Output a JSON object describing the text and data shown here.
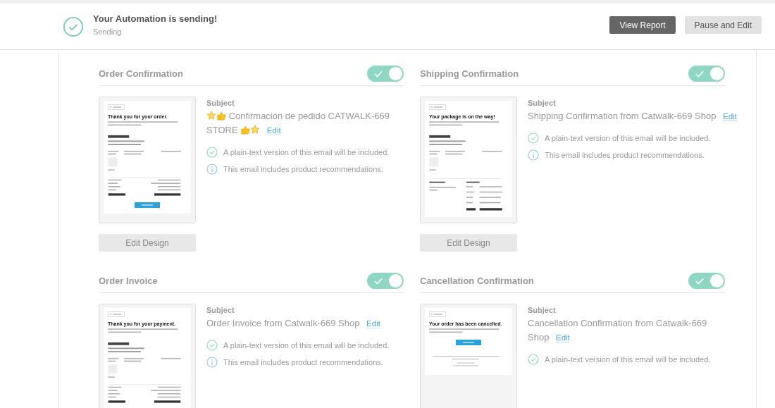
{
  "status": {
    "title": "Your Automation is sending!",
    "subtitle": "Sending"
  },
  "actions": [
    {
      "label": "View Report",
      "kind": "primary"
    },
    {
      "label": "Pause and Edit",
      "kind": "secondary"
    }
  ],
  "emails": [
    {
      "title": "Order Confirmation",
      "on": true,
      "subject_lines": [
        "Confirmación de pedido CATWALK-669",
        "STORE"
      ],
      "decorated": true,
      "edit": "Edit",
      "subject_label": "Subject",
      "design_button": "Edit Design",
      "notes": [
        {
          "kind": "check",
          "text": "A plain-text version of this email will be included."
        },
        {
          "kind": "info",
          "text": "This email includes product recommendations."
        }
      ],
      "preview": {
        "heading": "Thank you for your order.",
        "blocks": [
          {
            "kind": "text"
          },
          {
            "kind": "details"
          },
          {
            "kind": "product"
          },
          {
            "kind": "totals"
          },
          {
            "kind": "button"
          }
        ]
      }
    },
    {
      "title": "Shipping Confirmation",
      "on": true,
      "subject_lines": [
        "Shipping Confirmation from Catwalk-669 Shop"
      ],
      "decorated": false,
      "edit": "Edit",
      "subject_label": "Subject",
      "design_button": "Edit Design",
      "notes": [
        {
          "kind": "check",
          "text": "A plain-text version of this email will be included."
        },
        {
          "kind": "info",
          "text": "This email includes product recommendations."
        }
      ],
      "preview": {
        "heading": "Your package is on the way!",
        "blocks": [
          {
            "kind": "text"
          },
          {
            "kind": "details"
          },
          {
            "kind": "product"
          },
          {
            "kind": "split"
          }
        ]
      }
    },
    {
      "title": "Order Invoice",
      "on": true,
      "subject_lines": [
        "Order Invoice from Catwalk-669 Shop"
      ],
      "decorated": false,
      "edit": "Edit",
      "subject_label": "Subject",
      "notes": [
        {
          "kind": "check",
          "text": "A plain-text version of this email will be included."
        },
        {
          "kind": "info",
          "text": "This email includes product recommendations."
        }
      ],
      "preview": {
        "heading": "Thank you for your payment.",
        "blocks": [
          {
            "kind": "text"
          },
          {
            "kind": "details"
          },
          {
            "kind": "product"
          },
          {
            "kind": "totals"
          }
        ]
      }
    },
    {
      "title": "Cancellation Confirmation",
      "on": true,
      "subject_lines": [
        "Cancellation Confirmation from Catwalk-669",
        "Shop"
      ],
      "decorated": false,
      "edit": "Edit",
      "subject_label": "Subject",
      "notes": [
        {
          "kind": "check",
          "text": "A plain-text version of this email will be included."
        }
      ],
      "preview": {
        "heading": "Your order has been cancelled.",
        "blocks": [
          {
            "kind": "text"
          },
          {
            "kind": "button"
          },
          {
            "kind": "footer"
          }
        ]
      }
    }
  ]
}
